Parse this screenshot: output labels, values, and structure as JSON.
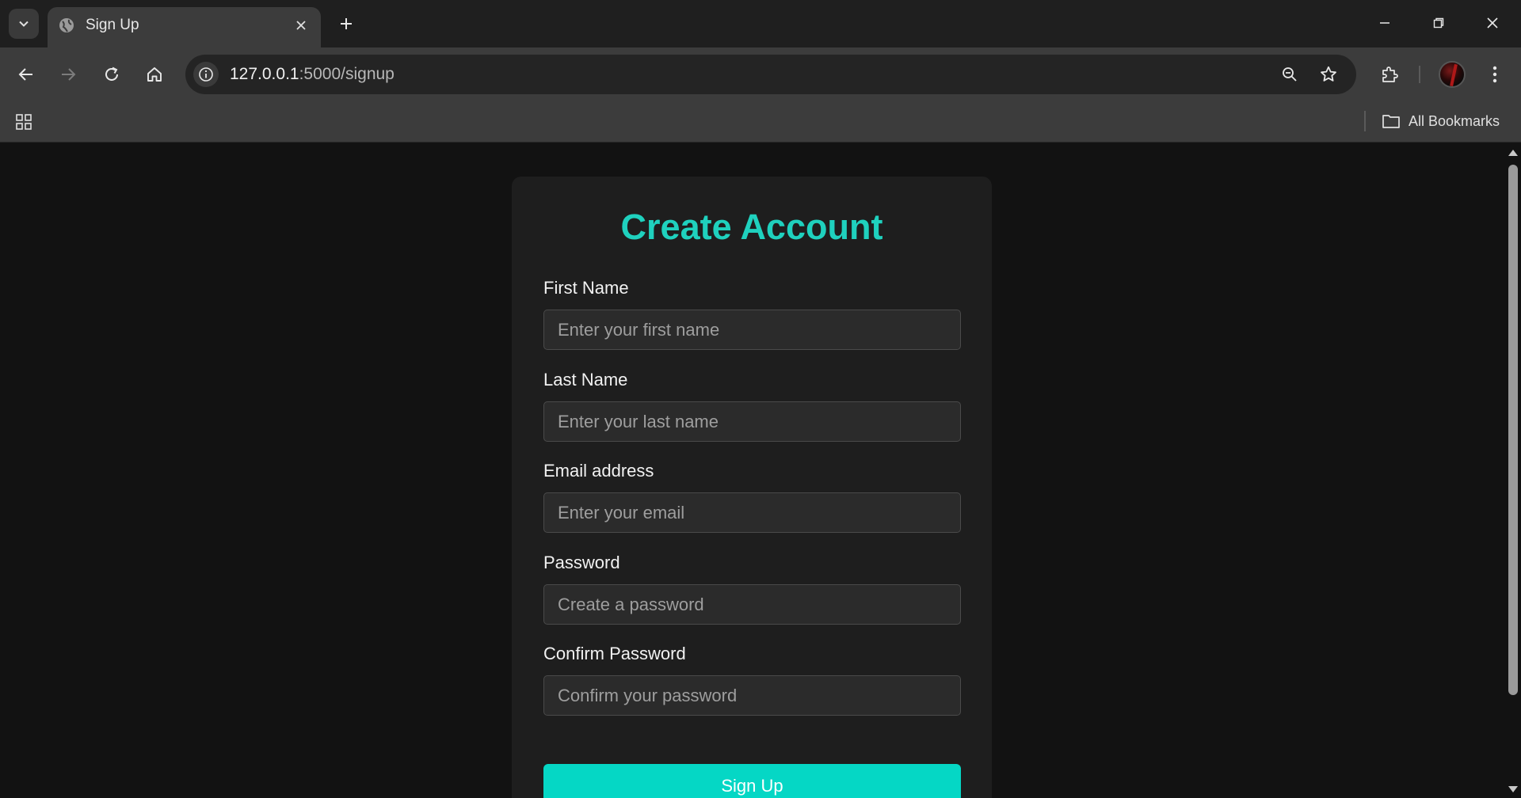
{
  "browser": {
    "tab": {
      "title": "Sign Up"
    },
    "address_bar": {
      "host": "127.0.0.1",
      "path": ":5000/signup"
    },
    "bookmarks": {
      "all_label": "All Bookmarks"
    }
  },
  "page": {
    "title": "Create Account",
    "fields": [
      {
        "label": "First Name",
        "placeholder": "Enter your first name"
      },
      {
        "label": "Last Name",
        "placeholder": "Enter your last name"
      },
      {
        "label": "Email address",
        "placeholder": "Enter your email"
      },
      {
        "label": "Password",
        "placeholder": "Create a password"
      },
      {
        "label": "Confirm Password",
        "placeholder": "Confirm your password"
      }
    ],
    "submit_label": "Sign Up"
  },
  "colors": {
    "accent": "#1fd1be",
    "button": "#05d7c5",
    "page_background": "#121212",
    "card_background": "#1e1e1e"
  },
  "icons": [
    "tab-search-icon",
    "globe-icon",
    "close-icon",
    "plus-icon",
    "minimize-icon",
    "restore-icon",
    "back-icon",
    "forward-icon",
    "reload-icon",
    "home-icon",
    "info-icon",
    "zoom-icon",
    "star-icon",
    "extensions-icon",
    "menu-icon",
    "apps-icon",
    "folder-icon"
  ]
}
